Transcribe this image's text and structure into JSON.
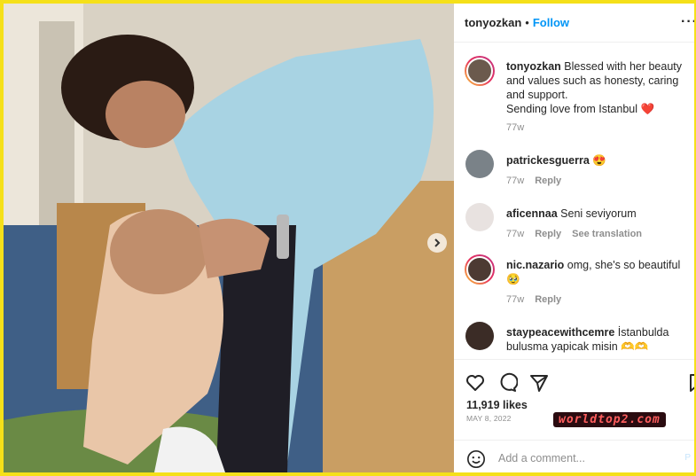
{
  "post": {
    "author": "tonyozkan",
    "dot": "•",
    "follow_label": "Follow",
    "more_label": "···",
    "caption_name": "tonyozkan",
    "caption_text": "Blessed with her beauty and values such as honesty, caring and support.",
    "caption_text2": "Sending love from Istanbul ❤️",
    "caption_age": "77w"
  },
  "comments": [
    {
      "user": "patrickesguerra",
      "text": "😍",
      "age": "77w",
      "reply": "Reply",
      "translate": ""
    },
    {
      "user": "aficennaa",
      "text": "Seni seviyorum",
      "age": "77w",
      "reply": "Reply",
      "translate": "See translation"
    },
    {
      "user": "nic.nazario",
      "text": "omg, she's so beautiful 🥹",
      "age": "77w",
      "reply": "Reply",
      "translate": ""
    },
    {
      "user": "staypeacewithcemre",
      "text": "İstanbulda bulusma yapicak misin 🫶🫶",
      "age": "",
      "reply": "",
      "translate": ""
    }
  ],
  "engagement": {
    "likes": "11,919 likes",
    "date": "MAY 8, 2022"
  },
  "add_comment": {
    "placeholder": "Add a comment...",
    "post_label": "P"
  },
  "watermark": "worldtop2.com",
  "colors": {
    "frame": "#f5e019",
    "follow_blue": "#0095f6",
    "muted": "#8e8e8e"
  },
  "icons": [
    "heart-icon",
    "comment-icon",
    "share-icon",
    "bookmark-icon",
    "emoji-icon",
    "chevron-right-icon",
    "more-icon"
  ]
}
